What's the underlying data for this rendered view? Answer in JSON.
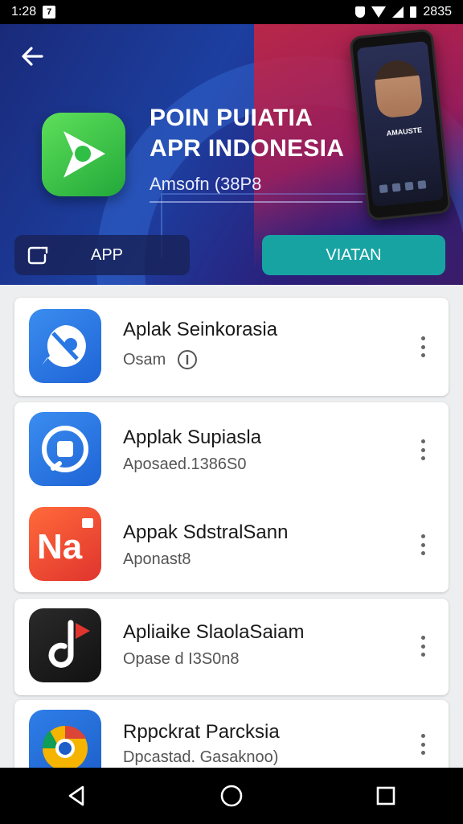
{
  "status_bar": {
    "time": "1:28",
    "badge": "7",
    "battery_text": "2835"
  },
  "hero": {
    "title_line1": "POIN PUIATIA",
    "title_line2": "APR INDONESIA",
    "subtitle": "Amsofn (38P8",
    "phone_caption": "AMAUSTE",
    "app_button_label": "APP",
    "secondary_button_label": "VIATAN"
  },
  "apps": [
    {
      "name": "Aplak Seinkorasia",
      "meta": "Osam"
    },
    {
      "name": "Applak Supiasla",
      "meta": "Aposaed.1386S0"
    },
    {
      "name": "Appak SdstralSann",
      "meta": "Aponast8"
    },
    {
      "name": "Apliaike SlaolaSaiam",
      "meta": "Opase d I3S0n8"
    },
    {
      "name": "Rppckrat Parcksia",
      "meta": "Dpcastad. Gasaknoo)"
    }
  ],
  "colors": {
    "accent_teal": "#18a3a3",
    "hero_blue": "#1c3fa0",
    "hero_red": "#d4233a"
  }
}
